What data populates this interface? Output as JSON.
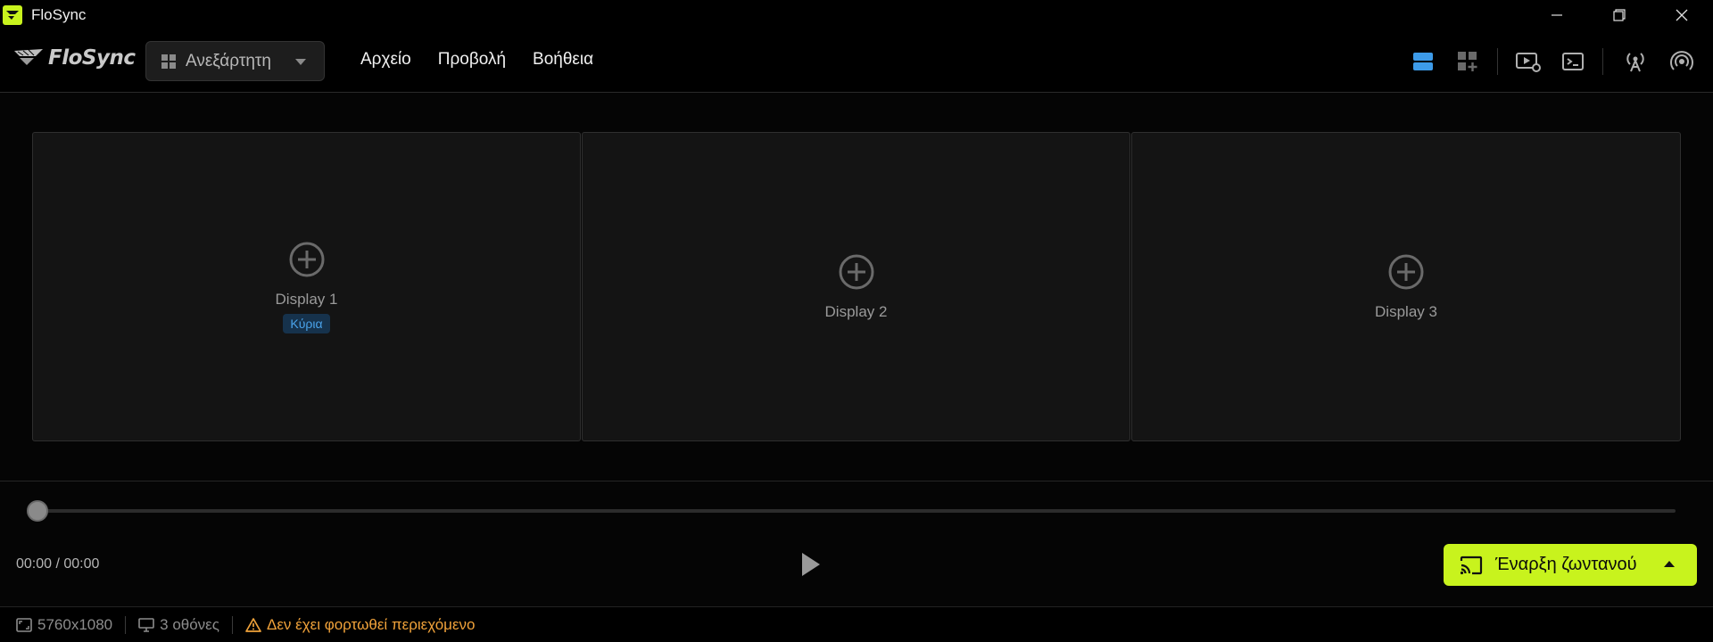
{
  "window": {
    "title": "FloSync"
  },
  "logo": {
    "text": "FloSync"
  },
  "mode_select": {
    "value": "Ανεξάρτητη"
  },
  "menu": {
    "items": [
      "Αρχείο",
      "Προβολή",
      "Βοήθεια"
    ]
  },
  "toolbar_icons": [
    "layout-rows-icon",
    "layout-grid-add-icon",
    "video-settings-icon",
    "terminal-icon",
    "broadcast-antenna-icon",
    "signal-stream-icon"
  ],
  "displays": [
    {
      "label": "Display 1",
      "badge": "Κύρια"
    },
    {
      "label": "Display 2"
    },
    {
      "label": "Display 3"
    }
  ],
  "playback": {
    "time": "00:00 / 00:00",
    "progress": 0
  },
  "live_button": {
    "label": "Έναρξη ζωντανού"
  },
  "status": {
    "resolution": "5760x1080",
    "screens": "3 οθόνες",
    "warning": "Δεν έχει φορτωθεί περιεχόμενο"
  },
  "colors": {
    "accent": "#c8f31d",
    "primary_badge_bg": "#16324c",
    "primary_badge_text": "#4aa3ea",
    "warning": "#f0a23a",
    "active_icon": "#3d9be9"
  }
}
